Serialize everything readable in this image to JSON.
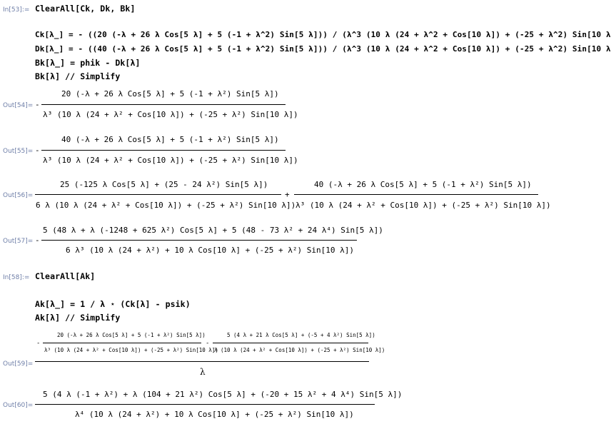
{
  "cells": {
    "in53": {
      "label": "In[53]:=",
      "code": "ClearAll[Ck, Dk, Bk]"
    },
    "in54_block": {
      "line1": "Ck[λ_] = - ((20 (-λ + 26 λ Cos[5 λ] + 5 (-1 + λ^2) Sin[5 λ])) / (λ^3 (10 λ (24 + λ^2 + Cos[10 λ]) + (-25 + λ^2) Sin[10 λ])))",
      "line2": "Dk[λ_] = - ((40 (-λ + 26 λ Cos[5 λ] + 5 (-1 + λ^2) Sin[5 λ])) / (λ^3 (10 λ (24 + λ^2 + Cos[10 λ]) + (-25 + λ^2) Sin[10 λ])))",
      "line3": "Bk[λ_] = phik - Dk[λ]",
      "line4": "Bk[λ] // Simplify"
    },
    "out54": {
      "label": "Out[54]=",
      "sign": "-",
      "num": "20 (-λ + 26 λ Cos[5 λ] + 5 (-1 + λ²) Sin[5 λ])",
      "den": "λ³ (10 λ (24 + λ² + Cos[10 λ]) + (-25 + λ²) Sin[10 λ])"
    },
    "out55": {
      "label": "Out[55]=",
      "sign": "-",
      "num": "40 (-λ + 26 λ Cos[5 λ] + 5 (-1 + λ²) Sin[5 λ])",
      "den": "λ³ (10 λ (24 + λ² + Cos[10 λ]) + (-25 + λ²) Sin[10 λ])"
    },
    "out56": {
      "label": "Out[56]=",
      "num1": "25 (-125 λ Cos[5 λ] + (25 - 24 λ²) Sin[5 λ])",
      "den1": "6 λ (10 λ (24 + λ² + Cos[10 λ]) + (-25 + λ²) Sin[10 λ])",
      "plus": "+",
      "num2": "40 (-λ + 26 λ Cos[5 λ] + 5 (-1 + λ²) Sin[5 λ])",
      "den2": "λ³ (10 λ (24 + λ² + Cos[10 λ]) + (-25 + λ²) Sin[10 λ])"
    },
    "out57": {
      "label": "Out[57]=",
      "sign": "-",
      "num": "5 (48 λ + λ (-1248 + 625 λ²) Cos[5 λ] + 5 (48 - 73 λ² + 24 λ⁴) Sin[5 λ])",
      "den": "6 λ³ (10 λ (24 + λ²) + 10 λ Cos[10 λ] + (-25 + λ²) Sin[10 λ])"
    },
    "in58": {
      "label": "In[58]:=",
      "code": "ClearAll[Ak]"
    },
    "in59_block": {
      "line1": "Ak[λ_] = 1 / λ ⋆ (Ck[λ] - psik)",
      "line2": "Ak[λ] // Simplify"
    },
    "out59": {
      "label": "Out[59]=",
      "sign1": "-",
      "num1": "20 (-λ + 26 λ Cos[5 λ] + 5 (-1 + λ²) Sin[5 λ])",
      "den1": "λ³ (10 λ (24 + λ² + Cos[10 λ]) + (-25 + λ²) Sin[10 λ])",
      "sign2": "-",
      "num2": "5 (4 λ + 21 λ Cos[5 λ] + (-5 + 4 λ²) Sin[5 λ])",
      "den2": "λ (10 λ (24 + λ² + Cos[10 λ]) + (-25 + λ²) Sin[10 λ])",
      "den": "λ"
    },
    "out60": {
      "label": "Out[60]=",
      "num": "5 (4 λ (-1 + λ²) + λ (104 + 21 λ²) Cos[5 λ] + (-20 + 15 λ² + 4 λ⁴) Sin[5 λ])",
      "den": "λ⁴ (10 λ (24 + λ²) + 10 λ Cos[10 λ] + (-25 + λ²) Sin[10 λ])"
    }
  }
}
